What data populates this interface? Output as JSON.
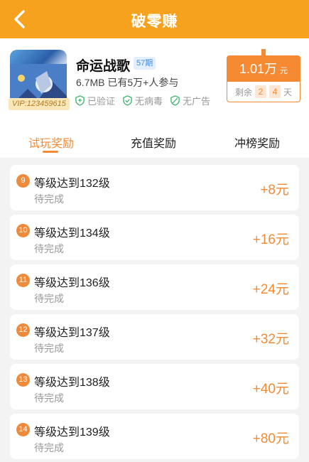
{
  "header": {
    "title": "破零赚",
    "back_icon": "chevron-left-icon"
  },
  "game": {
    "name": "命运战歌",
    "issue": "57期",
    "size": "6.7MB",
    "participants": "已有5万+人参与",
    "vip": "VIP:123459615",
    "tags": [
      {
        "label": "已验证",
        "icon": "verified-shield-icon"
      },
      {
        "label": "无病毒",
        "icon": "check-shield-icon"
      },
      {
        "label": "无广告",
        "icon": "no-ads-shield-icon"
      }
    ]
  },
  "reward": {
    "amount": "1.01万",
    "unit": "元",
    "remaining_label": "剩余",
    "digit1": "2",
    "digit2": "4",
    "days_label": "天"
  },
  "tabs": [
    {
      "label": "试玩奖励",
      "active": true
    },
    {
      "label": "充值奖励",
      "active": false
    },
    {
      "label": "冲榜奖励",
      "active": false
    }
  ],
  "tasks": [
    {
      "num": "9",
      "name": "等级达到132级",
      "status": "待完成",
      "amount": "+8元"
    },
    {
      "num": "10",
      "name": "等级达到134级",
      "status": "待完成",
      "amount": "+16元"
    },
    {
      "num": "11",
      "name": "等级达到136级",
      "status": "待完成",
      "amount": "+24元"
    },
    {
      "num": "12",
      "name": "等级达到137级",
      "status": "待完成",
      "amount": "+32元"
    },
    {
      "num": "13",
      "name": "等级达到138级",
      "status": "待完成",
      "amount": "+40元"
    },
    {
      "num": "14",
      "name": "等级达到139级",
      "status": "待完成",
      "amount": "+80元"
    }
  ],
  "colors": {
    "header": "#f6a21f",
    "accent": "#f58a33",
    "background": "#f3f3f3"
  }
}
